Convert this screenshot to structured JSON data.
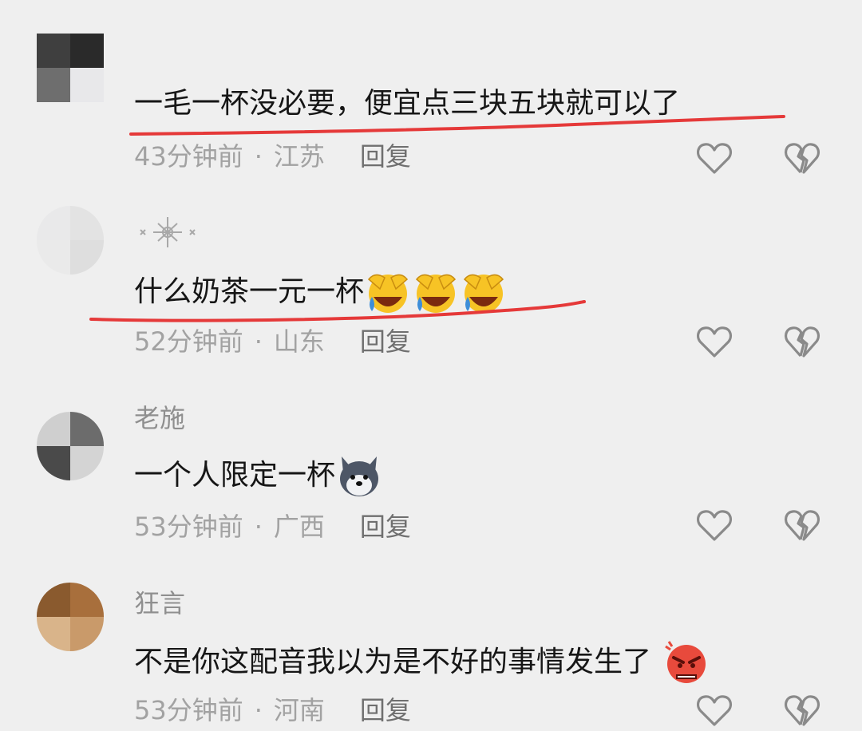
{
  "comments": [
    {
      "username": "",
      "text": "一毛一杯没必要，便宜点三块五块就可以了",
      "emojis": [],
      "time": "43分钟前",
      "location": "江苏",
      "reply": "回复",
      "avatar_colors": [
        "#3f3f3f",
        "#2a2a2a",
        "#6e6e6e",
        "#e8e8ea"
      ],
      "underline_color": "#e53939"
    },
    {
      "username": "",
      "text": "什么奶茶一元一杯",
      "emojis": [
        "laughing-crying-emoji",
        "laughing-crying-emoji",
        "laughing-crying-emoji"
      ],
      "time": "52分钟前",
      "location": "山东",
      "reply": "回复",
      "avatar_colors": [
        "#e9e9ea",
        "#e3e3e3",
        "#eaeaea",
        "#dedede"
      ],
      "underline_color": "#e53939"
    },
    {
      "username": "老施",
      "text": "一个人限定一杯",
      "emojis": [
        "husky-dog-emoji"
      ],
      "time": "53分钟前",
      "location": "广西",
      "reply": "回复",
      "avatar_colors": [
        "#cfcfcf",
        "#6c6c6c",
        "#4a4a4a",
        "#d4d4d4"
      ]
    },
    {
      "username": "狂言",
      "text": "不是你这配音我以为是不好的事情发生了",
      "emojis": [
        "angry-face-emoji"
      ],
      "time": "53分钟前",
      "location": "河南",
      "reply": "回复",
      "avatar_colors": [
        "#8a5a2e",
        "#a86f3c",
        "#d9b48a",
        "#c99a6a"
      ]
    }
  ],
  "separator": "·",
  "icons": {
    "like": "heart-outline-icon",
    "dislike": "broken-heart-icon"
  },
  "colors": {
    "background": "#efefef",
    "icon_stroke": "#8a8a8a"
  }
}
